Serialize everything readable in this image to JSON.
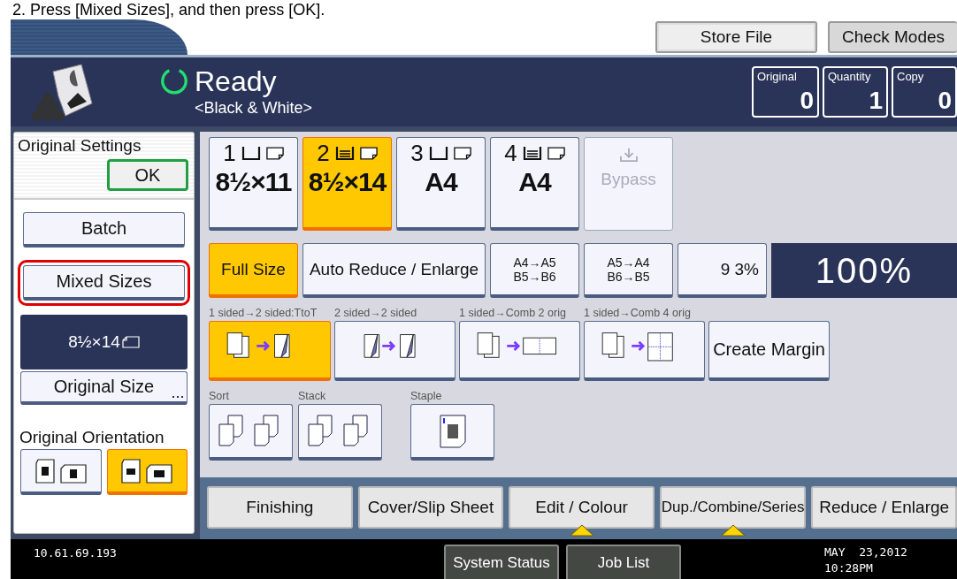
{
  "caption": "2. Press [Mixed Sizes], and then press [OK].",
  "header_buttons": [
    {
      "label": "Store File"
    },
    {
      "label": "Check Modes"
    }
  ],
  "status": {
    "title": "Ready",
    "mode": "<Black & White>"
  },
  "counters": [
    {
      "label": "Original",
      "value": "0"
    },
    {
      "label": "Quantity",
      "value": "1"
    },
    {
      "label": "Copy",
      "value": "0"
    }
  ],
  "original_settings": {
    "title": "Original Settings",
    "ok": "OK",
    "options": [
      {
        "label": "Batch",
        "highlighted": false
      },
      {
        "label": "Mixed Sizes",
        "highlighted": true
      }
    ],
    "size": "8½×14",
    "size_button": "Original Size",
    "orientation_title": "Original Orientation",
    "orientations": [
      {
        "kind": "portrait",
        "selected": false
      },
      {
        "kind": "landscape",
        "selected": true
      }
    ]
  },
  "trays": [
    {
      "kind": "tray",
      "number": "1",
      "size": "8½×11",
      "loaded": false,
      "selected": false,
      "disabled": false
    },
    {
      "kind": "tray",
      "number": "2",
      "size": "8½×14",
      "loaded": true,
      "selected": true,
      "disabled": false
    },
    {
      "kind": "tray",
      "number": "3",
      "size": "A4",
      "loaded": false,
      "selected": false,
      "disabled": false
    },
    {
      "kind": "tray",
      "number": "4",
      "size": "A4",
      "loaded": true,
      "selected": false,
      "disabled": false
    },
    {
      "kind": "bypass",
      "label": "Bypass",
      "selected": false,
      "disabled": true
    }
  ],
  "ratios": [
    {
      "kind": "text",
      "label": "Full Size",
      "selected": true
    },
    {
      "kind": "text",
      "label": "Auto Reduce / Enlarge",
      "selected": false
    },
    {
      "kind": "pair",
      "lines": [
        "A4→A5",
        "B5→B6"
      ],
      "selected": false
    },
    {
      "kind": "pair",
      "lines": [
        "A5→A4",
        "B6→B5"
      ],
      "selected": false
    },
    {
      "kind": "text",
      "label": "9 3%",
      "selected": false
    }
  ],
  "ratio_display": "100%",
  "duplex": [
    {
      "label": "1 sided→2 sided:TtoT",
      "kind": "one-to-two",
      "selected": true
    },
    {
      "label": "2 sided→2 sided",
      "kind": "two-to-two",
      "selected": false
    },
    {
      "label": "1 sided→Comb 2 orig",
      "kind": "comb-2",
      "selected": false
    },
    {
      "label": "1 sided→Comb 4 orig",
      "kind": "comb-4",
      "selected": false
    }
  ],
  "create_margin": "Create Margin",
  "finishing": [
    {
      "label": "Sort",
      "kind": "sort",
      "selected": false
    },
    {
      "label": "Stack",
      "kind": "stack",
      "selected": false
    },
    {
      "label": "Staple",
      "kind": "staple",
      "selected": false
    }
  ],
  "tabs": [
    {
      "label": "Finishing",
      "marked": false
    },
    {
      "label": "Cover/Slip Sheet",
      "marked": false
    },
    {
      "label": "Edit / Colour",
      "marked": true
    },
    {
      "label": "Dup./Combine/Series",
      "marked": true
    },
    {
      "label": "Reduce / Enlarge",
      "marked": false
    }
  ],
  "status_bar": {
    "address": "10.61.69.193",
    "buttons": [
      "System Status",
      "Job List"
    ],
    "date": "MAY  23,2012",
    "time": "10:28PM"
  }
}
